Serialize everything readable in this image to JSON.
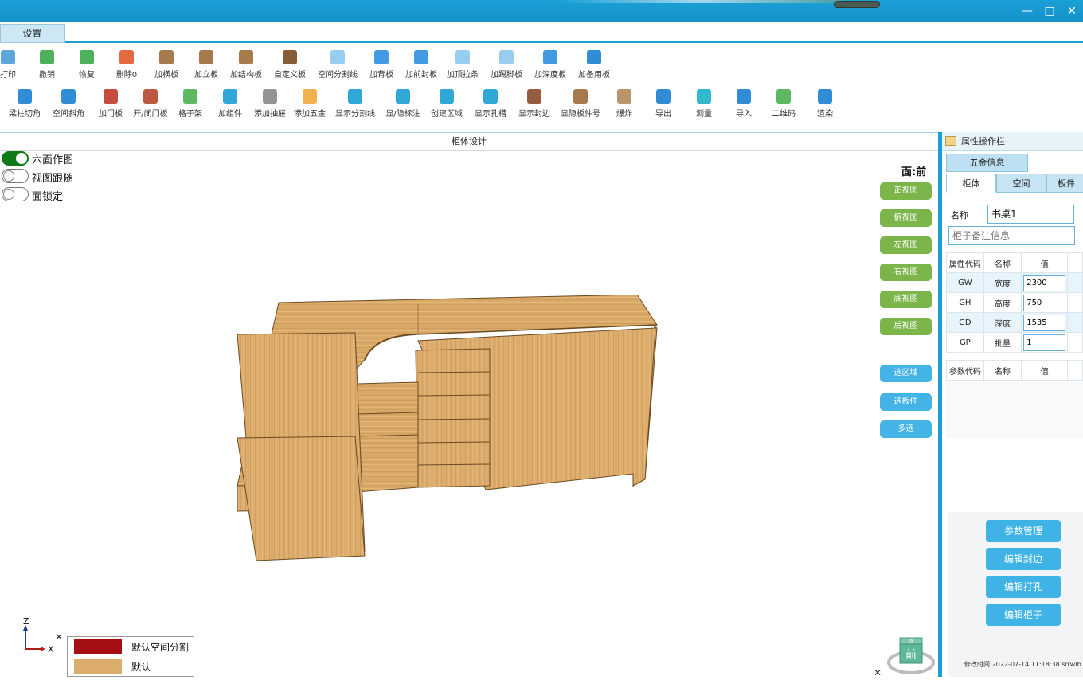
{
  "window": {
    "minimize_label": "—",
    "maximize_label": "□",
    "close_label": "✕"
  },
  "menu": {
    "settings_tab": "设置"
  },
  "toolbar": {
    "row1": [
      {
        "label": "打印",
        "icon": "print-icon",
        "color": "#4a9fd8"
      },
      {
        "label": "撤销",
        "icon": "undo-icon",
        "color": "#3aa84a"
      },
      {
        "label": "恢复",
        "icon": "redo-icon",
        "color": "#3aa84a"
      },
      {
        "label": "删除0",
        "icon": "trash-icon",
        "color": "#e05a2a"
      },
      {
        "label": "加横板",
        "icon": "horizontal-board-icon",
        "color": "#9c6b3a"
      },
      {
        "label": "加立板",
        "icon": "vertical-board-icon",
        "color": "#9c6b3a"
      },
      {
        "label": "加结构板",
        "icon": "structure-board-icon",
        "color": "#9c6b3a"
      },
      {
        "label": "自定义板",
        "icon": "custom-board-icon",
        "color": "#7a4a22"
      },
      {
        "label": "空间分割线",
        "icon": "space-divider-icon",
        "color": "#8ec8ee"
      },
      {
        "label": "加背板",
        "icon": "back-board-icon",
        "color": "#2e8fe0"
      },
      {
        "label": "加前封板",
        "icon": "front-seal-icon",
        "color": "#2e8fe0"
      },
      {
        "label": "加顶拉条",
        "icon": "top-strip-icon",
        "color": "#8ec8ee"
      },
      {
        "label": "加踢脚板",
        "icon": "kickboard-icon",
        "color": "#8ec8ee"
      },
      {
        "label": "加深度板",
        "icon": "depth-board-icon",
        "color": "#2e8fe0"
      },
      {
        "label": "加备用板",
        "icon": "spare-board-icon",
        "color": "#1a7fd0"
      }
    ],
    "row2": [
      {
        "label": "梁柱切角",
        "icon": "beam-cut-icon",
        "color": "#1a7fd0"
      },
      {
        "label": "空间斜角",
        "icon": "space-bevel-icon",
        "color": "#1a7fd0"
      },
      {
        "label": "加门板",
        "icon": "door-panel-icon",
        "color": "#c0392b"
      },
      {
        "label": "开/闭门板",
        "icon": "open-close-door-icon",
        "color": "#b5462a"
      },
      {
        "label": "格子架",
        "icon": "grid-rack-icon",
        "color": "#4caf50"
      },
      {
        "label": "加组件",
        "icon": "component-icon",
        "color": "#1a9fd3"
      },
      {
        "label": "添加抽屉",
        "icon": "drawer-icon",
        "color": "#888888"
      },
      {
        "label": "添加五金",
        "icon": "hardware-icon",
        "color": "#f2a93b"
      },
      {
        "label": "显示分割线",
        "icon": "show-divider-icon",
        "color": "#1a9fd3"
      },
      {
        "label": "显/隐标注",
        "icon": "toggle-annotation-icon",
        "color": "#1a9fd3"
      },
      {
        "label": "创建区域",
        "icon": "create-region-icon",
        "color": "#1a9fd3"
      },
      {
        "label": "显示孔槽",
        "icon": "show-holes-icon",
        "color": "#1a9fd3"
      },
      {
        "label": "显示封边",
        "icon": "show-edge-icon",
        "color": "#8b4a2b"
      },
      {
        "label": "显隐板件号",
        "icon": "board-number-icon",
        "color": "#9c6b3a"
      },
      {
        "label": "爆炸",
        "icon": "explode-icon",
        "color": "#b08a5a"
      },
      {
        "label": "导出",
        "icon": "export-icon",
        "color": "#1a7fd0"
      },
      {
        "label": "测量",
        "icon": "measure-icon",
        "color": "#1ab0c8"
      },
      {
        "label": "导入",
        "icon": "import-icon",
        "color": "#1a7fd0"
      },
      {
        "label": "二维码",
        "icon": "qrcode-icon",
        "color": "#4caf50"
      },
      {
        "label": "渲染",
        "icon": "render-icon",
        "color": "#1a7fd0"
      }
    ]
  },
  "design": {
    "title": "柜体设计",
    "toggles": [
      {
        "label": "六面作图",
        "on": true
      },
      {
        "label": "视图跟随",
        "on": false
      },
      {
        "label": "面锁定",
        "on": false
      }
    ],
    "face_label": "面:前",
    "view_buttons": [
      "正视图",
      "俯视图",
      "左视图",
      "右视图",
      "底视图",
      "后视图"
    ],
    "select_buttons": [
      "选区域",
      "选板件",
      "多选"
    ],
    "axis": {
      "z": "Z",
      "x": "X"
    },
    "legend": [
      {
        "label": "默认空间分割",
        "color": "#a50f12"
      },
      {
        "label": "默认",
        "color": "#dcac6c"
      }
    ],
    "close_label": "✕",
    "cube": {
      "top": "顶",
      "front": "前"
    }
  },
  "panel": {
    "title": "属性操作栏",
    "hardware_tab": "五金信息",
    "tabs": [
      "柜体",
      "空间",
      "板件"
    ],
    "name_label": "名称",
    "name_value": "书桌1",
    "note_placeholder": "柜子备注信息",
    "attr_header": [
      "属性代码",
      "名称",
      "值"
    ],
    "attrs": [
      {
        "code": "GW",
        "name": "宽度",
        "value": "2300"
      },
      {
        "code": "GH",
        "name": "高度",
        "value": "750"
      },
      {
        "code": "GD",
        "name": "深度",
        "value": "1535"
      },
      {
        "code": "GP",
        "name": "批量",
        "value": "1"
      }
    ],
    "param_header": [
      "参数代码",
      "名称",
      "值"
    ],
    "actions": [
      "参数管理",
      "编辑封边",
      "编辑打孔",
      "编辑柜子"
    ],
    "modified": "修改时间:2022-07-14 11:18:38 srrwlb"
  }
}
